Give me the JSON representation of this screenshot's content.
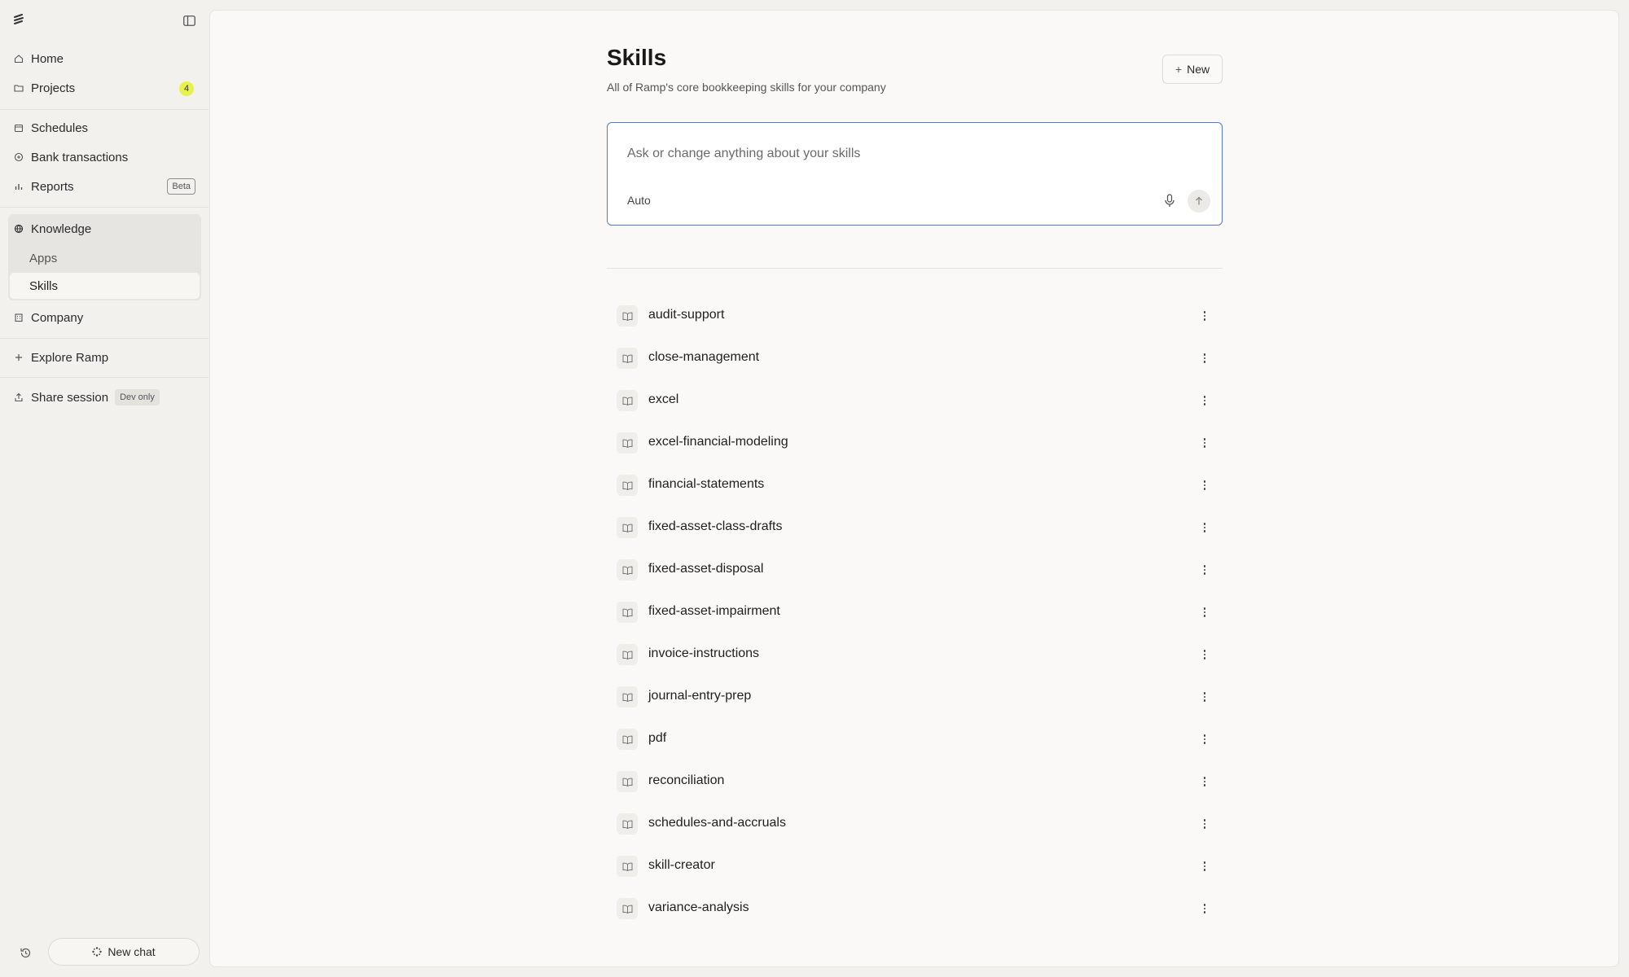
{
  "sidebar": {
    "nav": {
      "home": "Home",
      "projects": "Projects",
      "projects_count": "4",
      "schedules": "Schedules",
      "bank_transactions": "Bank transactions",
      "reports": "Reports",
      "reports_badge": "Beta",
      "knowledge": "Knowledge",
      "apps": "Apps",
      "skills": "Skills",
      "company": "Company",
      "explore": "Explore Ramp",
      "share_session": "Share session",
      "share_badge": "Dev only"
    },
    "new_chat": "New chat"
  },
  "main": {
    "title": "Skills",
    "subtitle": "All of Ramp's core bookkeeping skills for your company",
    "new_button": "New",
    "ask": {
      "placeholder": "Ask or change anything about your skills",
      "model": "Auto"
    },
    "skills": [
      "audit-support",
      "close-management",
      "excel",
      "excel-financial-modeling",
      "financial-statements",
      "fixed-asset-class-drafts",
      "fixed-asset-disposal",
      "fixed-asset-impairment",
      "invoice-instructions",
      "journal-entry-prep",
      "pdf",
      "reconciliation",
      "schedules-and-accruals",
      "skill-creator",
      "variance-analysis"
    ]
  },
  "icons": {
    "logo": "ramp-logo-icon",
    "collapse": "sidebar-toggle-icon",
    "home": "home-icon",
    "projects": "folder-icon",
    "schedules": "calendar-icon",
    "bank_transactions": "bank-icon",
    "reports": "bar-chart-icon",
    "knowledge": "globe-icon",
    "company": "building-icon",
    "explore": "plus-icon",
    "share": "share-icon",
    "history": "history-icon",
    "new_chat": "sparkle-icon",
    "skill": "book-icon",
    "more": "more-vertical-icon",
    "mic": "mic-icon",
    "send": "arrow-up-icon"
  },
  "colors": {
    "accent_badge": "#e5f34a",
    "input_focus_border": "#5577cc",
    "active_item_bg": "#f7f6f3",
    "group_bg": "#e7e5e1"
  }
}
